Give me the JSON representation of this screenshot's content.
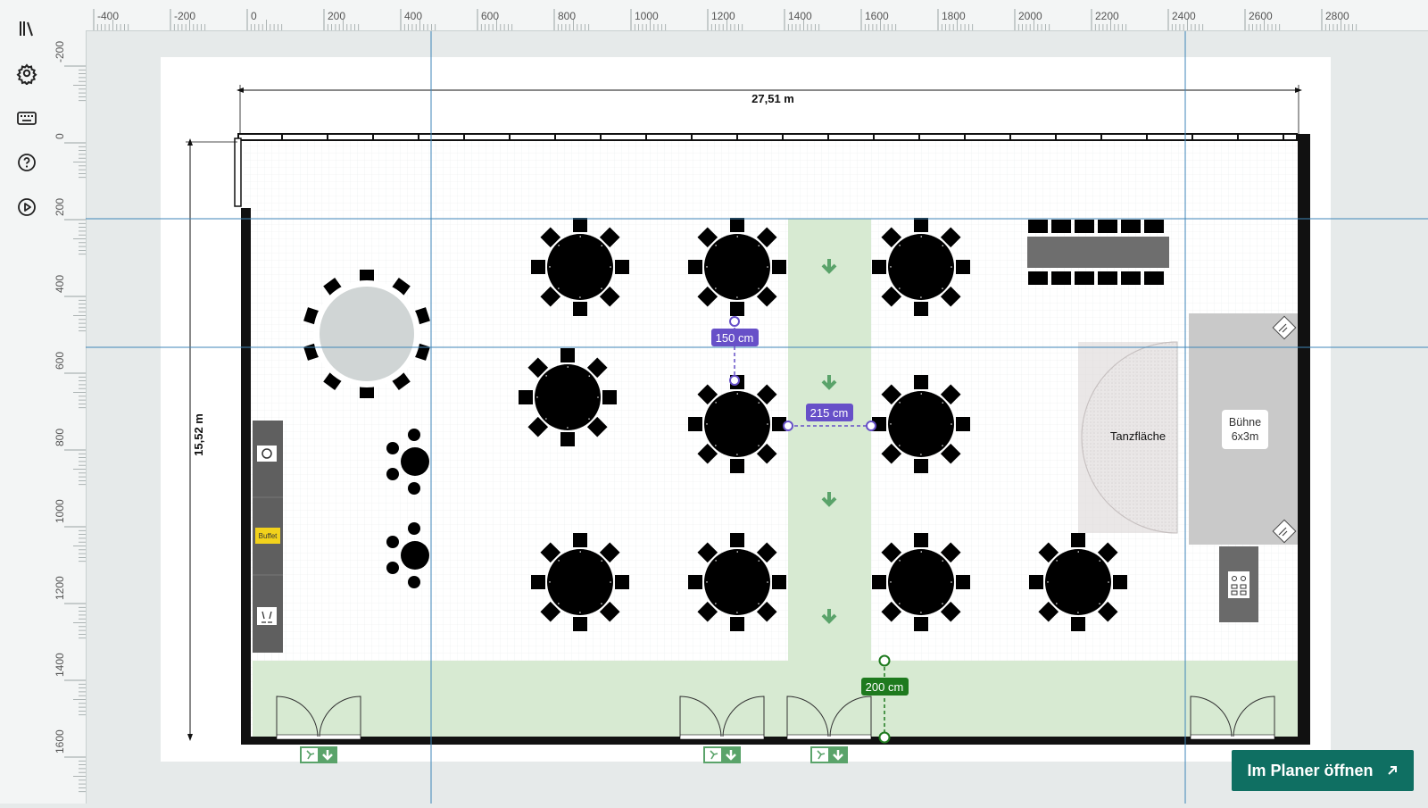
{
  "sidebar": {
    "items": [
      {
        "name": "library-icon",
        "label": "Bibliothek"
      },
      {
        "name": "settings-icon",
        "label": "Einstellungen"
      },
      {
        "name": "keyboard-icon",
        "label": "Tastatur"
      },
      {
        "name": "help-icon",
        "label": "Hilfe"
      },
      {
        "name": "play-icon",
        "label": "Abspielen"
      }
    ]
  },
  "ruler": {
    "top_labels": [
      "-400",
      "-200",
      "0",
      "200",
      "400",
      "600",
      "800",
      "1000",
      "1200",
      "1400",
      "1600",
      "1800",
      "2000",
      "2200",
      "2400",
      "2600",
      "2800"
    ],
    "left_labels": [
      "-200",
      "0",
      "200",
      "400",
      "600",
      "800",
      "1000",
      "1200",
      "1400",
      "1600"
    ]
  },
  "plan": {
    "width_label": "27,51 m",
    "height_label": "15,52 m",
    "dance_floor_label": "Tanzfläche",
    "stage_label_line1": "Bühne",
    "stage_label_line2": "6x3m",
    "buffet_label": "Buffet",
    "measure_1": "150 cm",
    "measure_2": "215 cm",
    "measure_3": "200 cm"
  },
  "colors": {
    "accent": "#0f6f62",
    "measure_purple": "#6750c8",
    "measure_green": "#1e7a1e",
    "aisle_green": "#d7ead2",
    "guide_blue": "#3f86b8",
    "wall": "#000000"
  },
  "cta": {
    "label": "Im Planer öffnen",
    "icon": "arrow-up-right-icon"
  }
}
